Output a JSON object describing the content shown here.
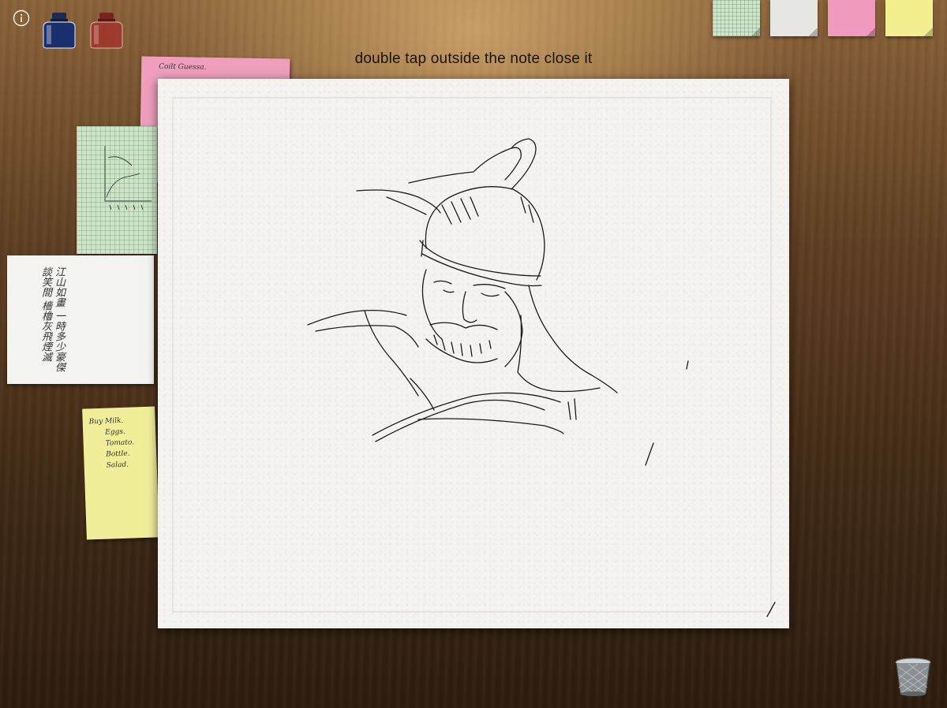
{
  "toolbar": {
    "info_icon": "info-icon",
    "inks": [
      {
        "name": "blue-ink",
        "color": "#1a3a8f"
      },
      {
        "name": "red-ink",
        "color": "#b3312c"
      }
    ]
  },
  "hint_text": "double tap outside the note close it",
  "swatches": [
    {
      "name": "green-grid",
      "color": "#cfe4cc"
    },
    {
      "name": "white",
      "color": "#e6e6e4"
    },
    {
      "name": "pink",
      "color": "#f09bbd"
    },
    {
      "name": "yellow",
      "color": "#f3ef8e"
    }
  ],
  "notes": {
    "pink_text": "Coilt Guessa.",
    "white_text": "江山如畫 一時多少豪傑 談笑間 檣櫓灰飛煙滅",
    "yellow_lines": [
      "Buy  Milk.",
      "Eggs.",
      "Tomato.",
      "Bottle.",
      "Salad."
    ]
  },
  "trash_icon": "trash-icon"
}
